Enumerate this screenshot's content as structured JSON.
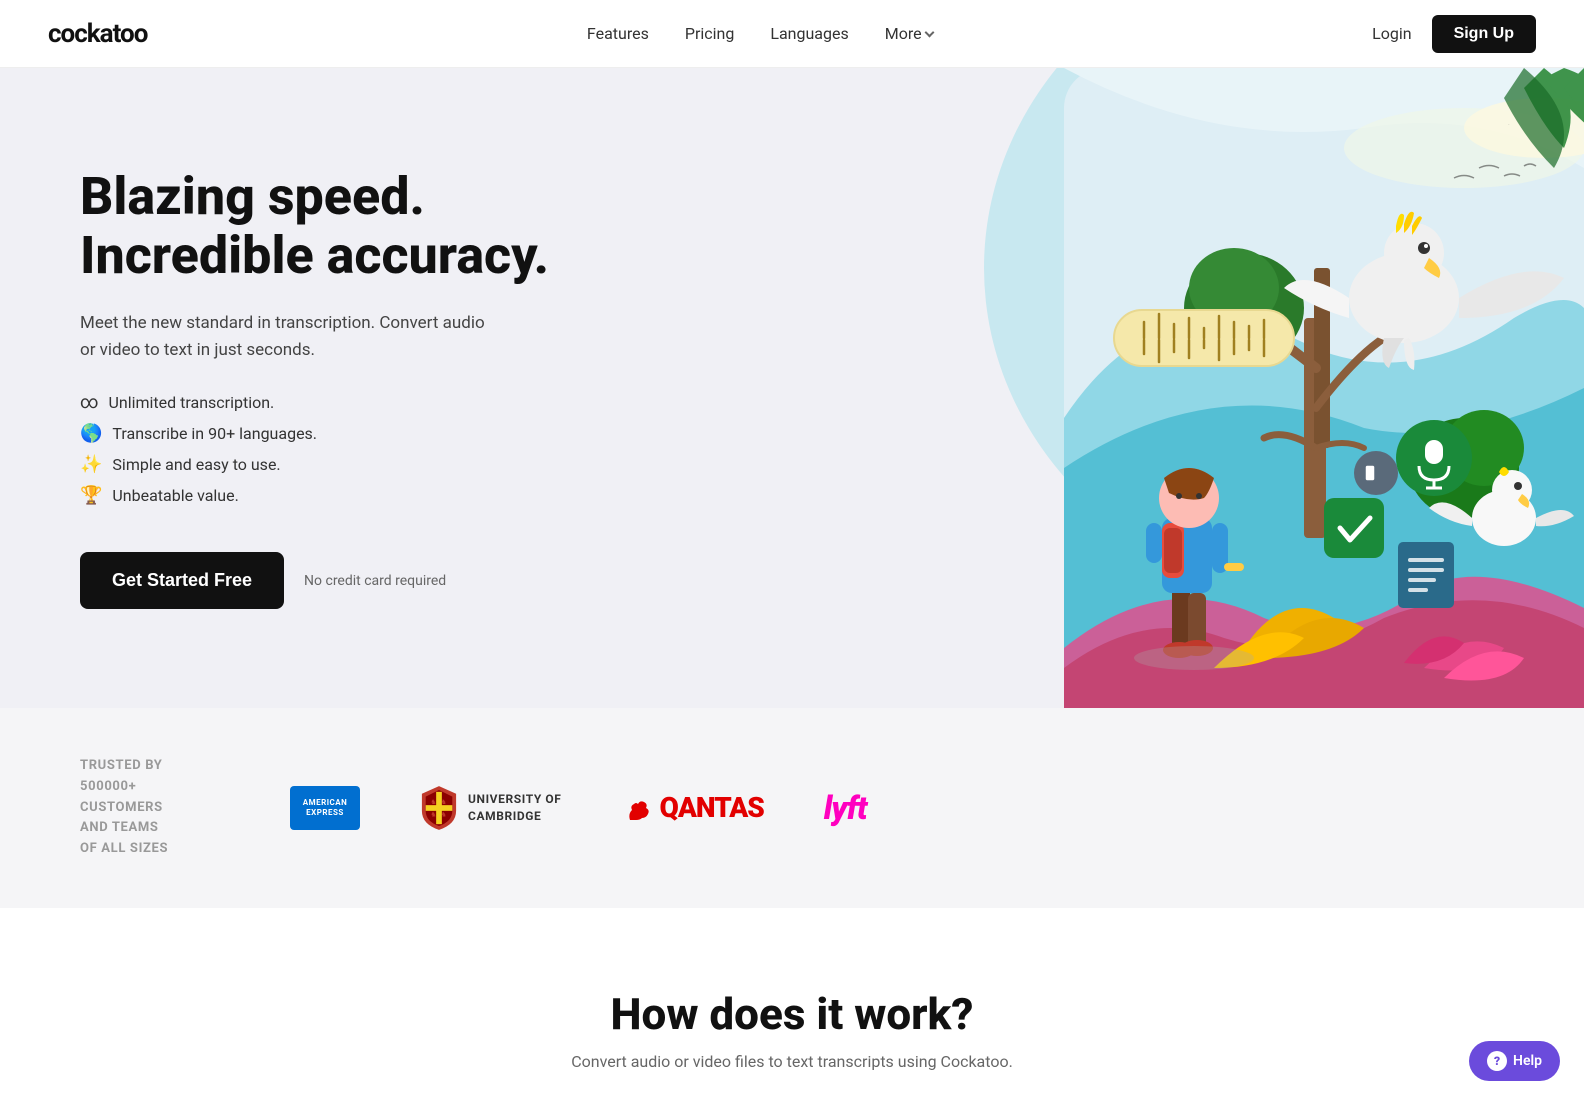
{
  "brand": {
    "name": "cockatoo"
  },
  "nav": {
    "links": [
      {
        "id": "features",
        "label": "Features"
      },
      {
        "id": "pricing",
        "label": "Pricing"
      },
      {
        "id": "languages",
        "label": "Languages"
      },
      {
        "id": "more",
        "label": "More"
      }
    ],
    "login_label": "Login",
    "signup_label": "Sign Up"
  },
  "hero": {
    "title_line1": "Blazing speed.",
    "title_line2": "Incredible accuracy.",
    "subtitle": "Meet the new standard in transcription. Convert audio or video to text in just seconds.",
    "features": [
      {
        "emoji": "∞",
        "text": "Unlimited transcription."
      },
      {
        "emoji": "🌎",
        "text": "Transcribe in 90+ languages."
      },
      {
        "emoji": "✨",
        "text": "Simple and easy to use."
      },
      {
        "emoji": "🏆",
        "text": "Unbeatable value."
      }
    ],
    "cta_label": "Get Started Free",
    "no_cc_text": "No credit card required"
  },
  "trusted": {
    "text_line1": "TRUSTED BY",
    "text_line2": "500000+",
    "text_line3": "CUSTOMERS",
    "text_line4": "AND TEAMS",
    "text_line5": "OF ALL SIZES",
    "logos": [
      {
        "id": "amex",
        "label": "AMERICAN EXPRESS"
      },
      {
        "id": "cambridge",
        "label": "UNIVERSITY OF CAMBRIDGE"
      },
      {
        "id": "qantas",
        "label": "QANTAS"
      },
      {
        "id": "lyft",
        "label": "lyft"
      }
    ]
  },
  "how": {
    "title": "How does it work?",
    "subtitle": "Convert audio or video files to text transcripts using Cockatoo."
  },
  "help": {
    "label": "Help"
  }
}
